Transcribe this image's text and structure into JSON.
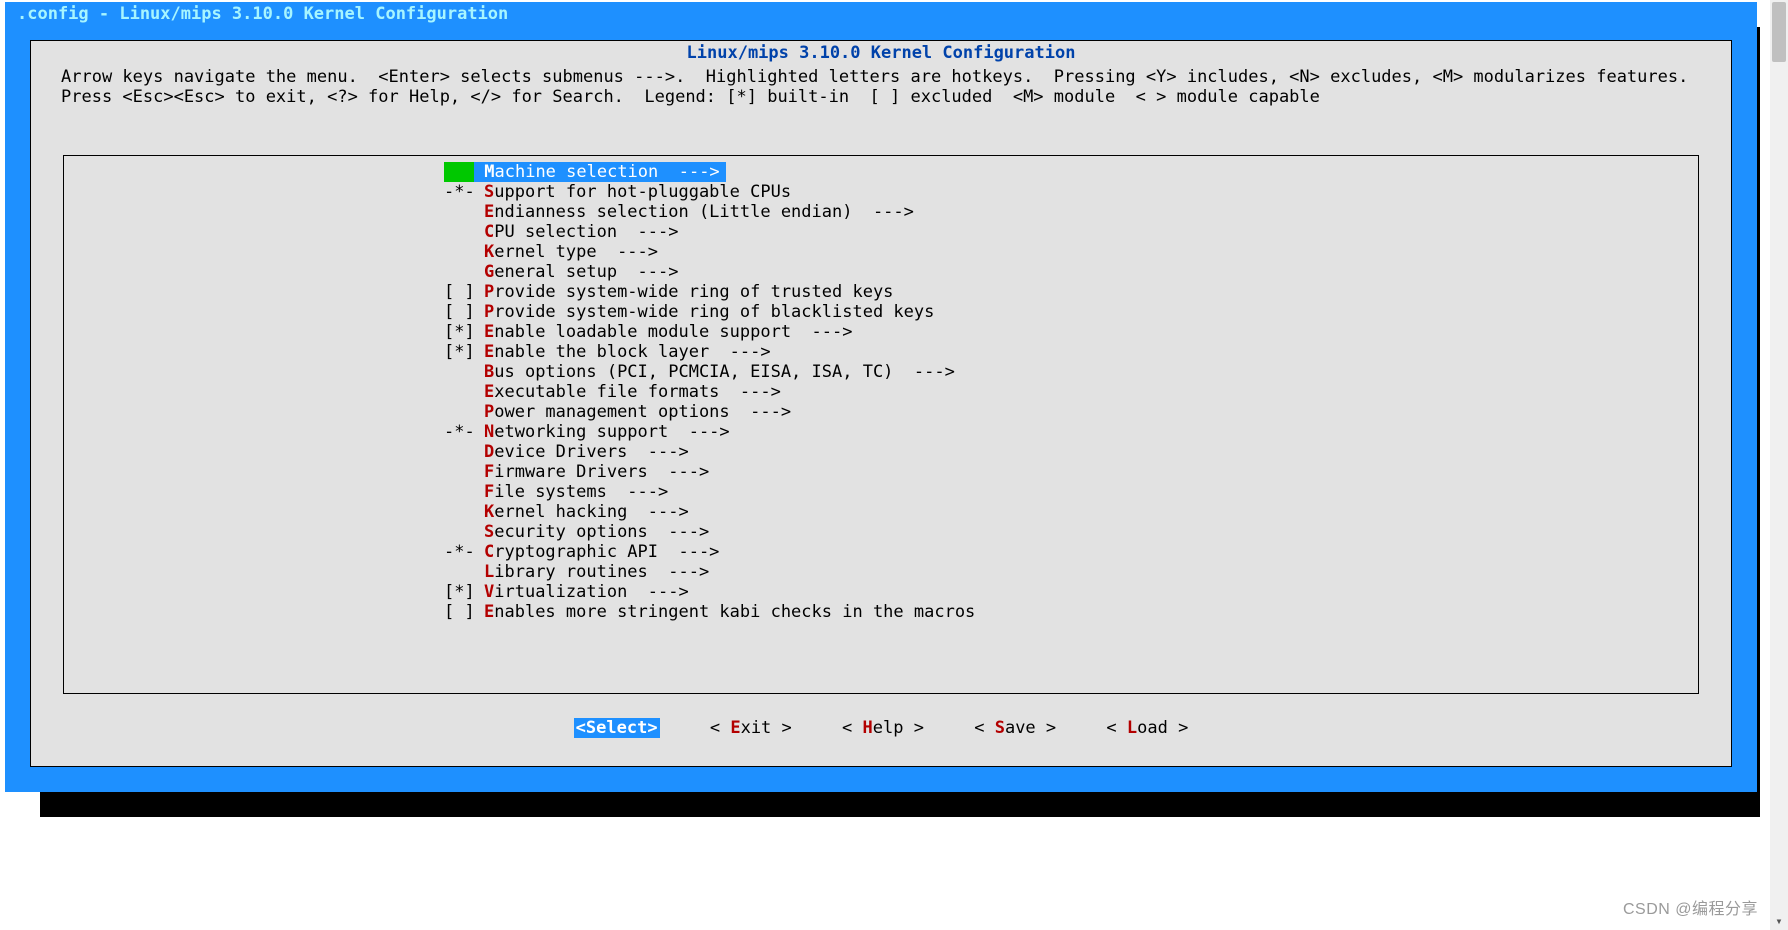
{
  "window": {
    "title": ".config - Linux/mips 3.10.0 Kernel Configuration"
  },
  "dialog": {
    "title": "Linux/mips 3.10.0 Kernel Configuration",
    "instructions": "Arrow keys navigate the menu.  <Enter> selects submenus --->.  Highlighted letters are hotkeys.  Pressing <Y> includes, <N> excludes, <M> modularizes features.  Press <Esc><Esc> to exit, <?> for Help, </> for Search.  Legend: [*] built-in  [ ] excluded  <M> module  < > module capable"
  },
  "menu": {
    "items": [
      {
        "prefix": "   ",
        "hot": "M",
        "rest": "achine selection  --->",
        "selected": true
      },
      {
        "prefix": "-*-",
        "hot": "S",
        "rest": "upport for hot-pluggable CPUs"
      },
      {
        "prefix": "   ",
        "hot": "E",
        "rest": "ndianness selection (Little endian)  --->"
      },
      {
        "prefix": "   ",
        "hot": "C",
        "rest": "PU selection  --->"
      },
      {
        "prefix": "   ",
        "hot": "K",
        "rest": "ernel type  --->"
      },
      {
        "prefix": "   ",
        "hot": "G",
        "rest": "eneral setup  --->"
      },
      {
        "prefix": "[ ]",
        "hot": "P",
        "rest": "rovide system-wide ring of trusted keys"
      },
      {
        "prefix": "[ ]",
        "hot": "P",
        "rest": "rovide system-wide ring of blacklisted keys"
      },
      {
        "prefix": "[*]",
        "hot": "E",
        "rest": "nable loadable module support  --->"
      },
      {
        "prefix": "[*]",
        "hot": "E",
        "rest": "nable the block layer  --->"
      },
      {
        "prefix": "   ",
        "hot": "B",
        "rest": "us options (PCI, PCMCIA, EISA, ISA, TC)  --->"
      },
      {
        "prefix": "   ",
        "hot": "E",
        "rest": "xecutable file formats  --->"
      },
      {
        "prefix": "   ",
        "hot": "P",
        "rest": "ower management options  --->"
      },
      {
        "prefix": "-*-",
        "hot": "N",
        "rest": "etworking support  --->"
      },
      {
        "prefix": "   ",
        "hot": "D",
        "rest": "evice Drivers  --->"
      },
      {
        "prefix": "   ",
        "hot": "F",
        "rest": "irmware Drivers  --->"
      },
      {
        "prefix": "   ",
        "hot": "F",
        "rest": "ile systems  --->"
      },
      {
        "prefix": "   ",
        "hot": "K",
        "rest": "ernel hacking  --->"
      },
      {
        "prefix": "   ",
        "hot": "S",
        "rest": "ecurity options  --->"
      },
      {
        "prefix": "-*-",
        "hot": "C",
        "rest": "ryptographic API  --->"
      },
      {
        "prefix": "   ",
        "hot": "L",
        "rest": "ibrary routines  --->"
      },
      {
        "prefix": "[*]",
        "hot": "V",
        "rest": "irtualization  --->"
      },
      {
        "prefix": "[ ]",
        "hot": "E",
        "rest": "nables more stringent kabi checks in the macros"
      }
    ]
  },
  "buttons": {
    "select": {
      "label_hot": "S",
      "label_rest": "elect",
      "selected": true
    },
    "exit": {
      "label_hot": "E",
      "label_rest": "xit"
    },
    "help": {
      "label_hot": "H",
      "label_rest": "elp"
    },
    "save": {
      "label_hot": "S",
      "label_rest": "ave"
    },
    "load": {
      "label_hot": "L",
      "label_rest": "oad"
    }
  },
  "watermark": "CSDN @编程分享"
}
